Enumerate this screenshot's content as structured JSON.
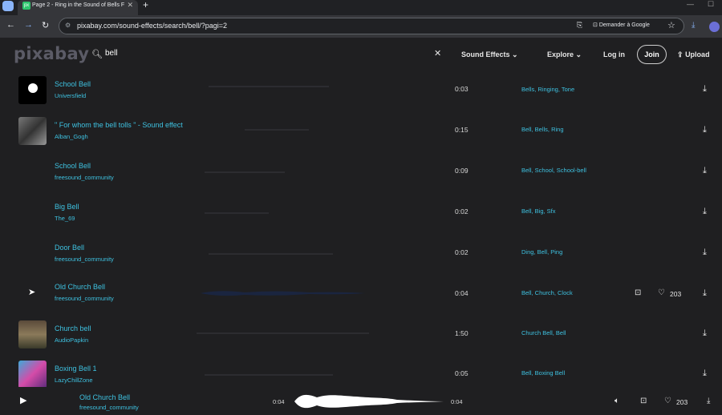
{
  "browser": {
    "tab_title": "Page 2 - Ring in the Sound of Bells F",
    "tab_favicon": "px",
    "url": "pixabay.com/sound-effects/search/bell/?pagi=2",
    "google_button": "Demander à Google"
  },
  "header": {
    "logo": "pixabay",
    "search_value": "bell",
    "sound_effects": "Sound Effects",
    "explore": "Explore",
    "login": "Log in",
    "join": "Join",
    "upload": "Upload"
  },
  "tracks": [
    {
      "title": "School Bell",
      "author": "Universfield",
      "duration": "0:03",
      "tags": "Bells, Ringing, Tone"
    },
    {
      "title": "\" For whom the bell tolls \" - Sound effect",
      "author": "Alban_Gogh",
      "duration": "0:15",
      "tags": "Bell, Bells, Ring"
    },
    {
      "title": "School Bell",
      "author": "freesound_community",
      "duration": "0:09",
      "tags": "Bell, School, School-bell"
    },
    {
      "title": "Big Bell",
      "author": "The_69",
      "duration": "0:02",
      "tags": "Bell, Big, Sfx"
    },
    {
      "title": "Door Bell",
      "author": "freesound_community",
      "duration": "0:02",
      "tags": "Ding, Bell, Ping"
    },
    {
      "title": "Old Church Bell",
      "author": "freesound_community",
      "duration": "0:04",
      "tags": "Bell, Church, Clock",
      "likes": "203"
    },
    {
      "title": "Church bell",
      "author": "AudioPapkin",
      "duration": "1:50",
      "tags": "Church Bell, Bell"
    },
    {
      "title": "Boxing Bell 1",
      "author": "LazyChillZone",
      "duration": "0:05",
      "tags": "Bell, Boxing Bell"
    }
  ],
  "player": {
    "title": "Old Church Bell",
    "author": "freesound_community",
    "elapsed": "0:04",
    "total": "0:04",
    "likes": "203"
  },
  "colors": {
    "accent": "#3ec1e0",
    "background": "#1f1f21"
  }
}
